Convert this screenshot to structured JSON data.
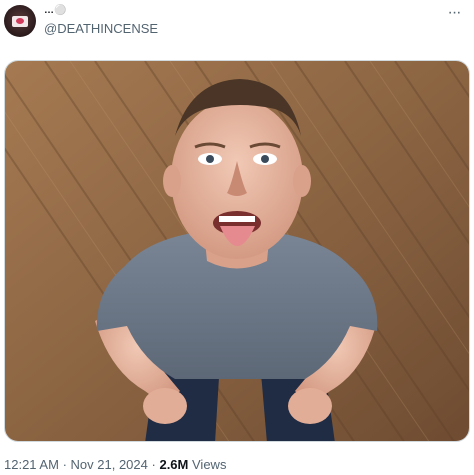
{
  "post": {
    "display_name": "…⚪",
    "handle": "@DEATHINCENSE",
    "image_alt": "Photo of a person looking up at the camera with tongue out, standing on a wooden floor",
    "time": "12:21 AM",
    "date": "Nov 21, 2024",
    "separator": "·",
    "views_count": "2.6M",
    "views_label": "Views"
  },
  "icons": {
    "more": "more-horizontal-icon",
    "avatar": "avatar-image"
  },
  "colors": {
    "text_primary": "#0f1419",
    "text_secondary": "#536471",
    "border": "#cfd9de"
  }
}
